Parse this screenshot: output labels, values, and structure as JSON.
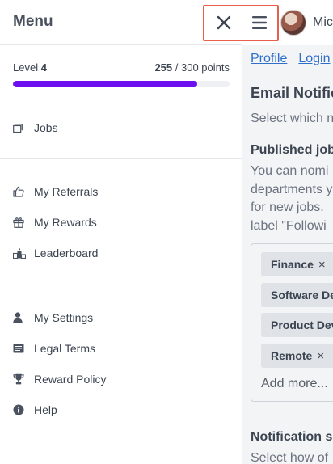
{
  "menu": {
    "title": "Menu",
    "level_label": "Level",
    "level_value": "4",
    "points_current": "255",
    "points_total": "/ 300 points",
    "progress_fraction": 0.85,
    "groups": [
      [
        {
          "label": "Jobs",
          "icon": "window-icon"
        }
      ],
      [
        {
          "label": "My Referrals",
          "icon": "thumbs-up-icon"
        },
        {
          "label": "My Rewards",
          "icon": "gift-icon"
        },
        {
          "label": "Leaderboard",
          "icon": "podium-icon"
        }
      ],
      [
        {
          "label": "My Settings",
          "icon": "user-icon"
        },
        {
          "label": "Legal Terms",
          "icon": "document-icon"
        },
        {
          "label": "Reward Policy",
          "icon": "trophy-icon"
        },
        {
          "label": "Help",
          "icon": "info-icon"
        }
      ]
    ],
    "colors": {
      "progress": "#6d0ef0",
      "highlight": "#e8604c"
    }
  },
  "page": {
    "user_name": "Mic",
    "tabs": [
      "Profile",
      "Login"
    ],
    "section_title": "Email Notific",
    "section_desc": "Select which n",
    "sub_title": "Published job",
    "sub_desc_lines": [
      "You can nomi",
      "departments y",
      "for new jobs.",
      "label \"Followi"
    ],
    "tags": [
      "Finance",
      "Software De",
      "Product Dev",
      "Remote"
    ],
    "tag_remove": "×",
    "add_more": "Add more...",
    "notif_title": "Notification s",
    "notif_desc": "Select how of"
  }
}
